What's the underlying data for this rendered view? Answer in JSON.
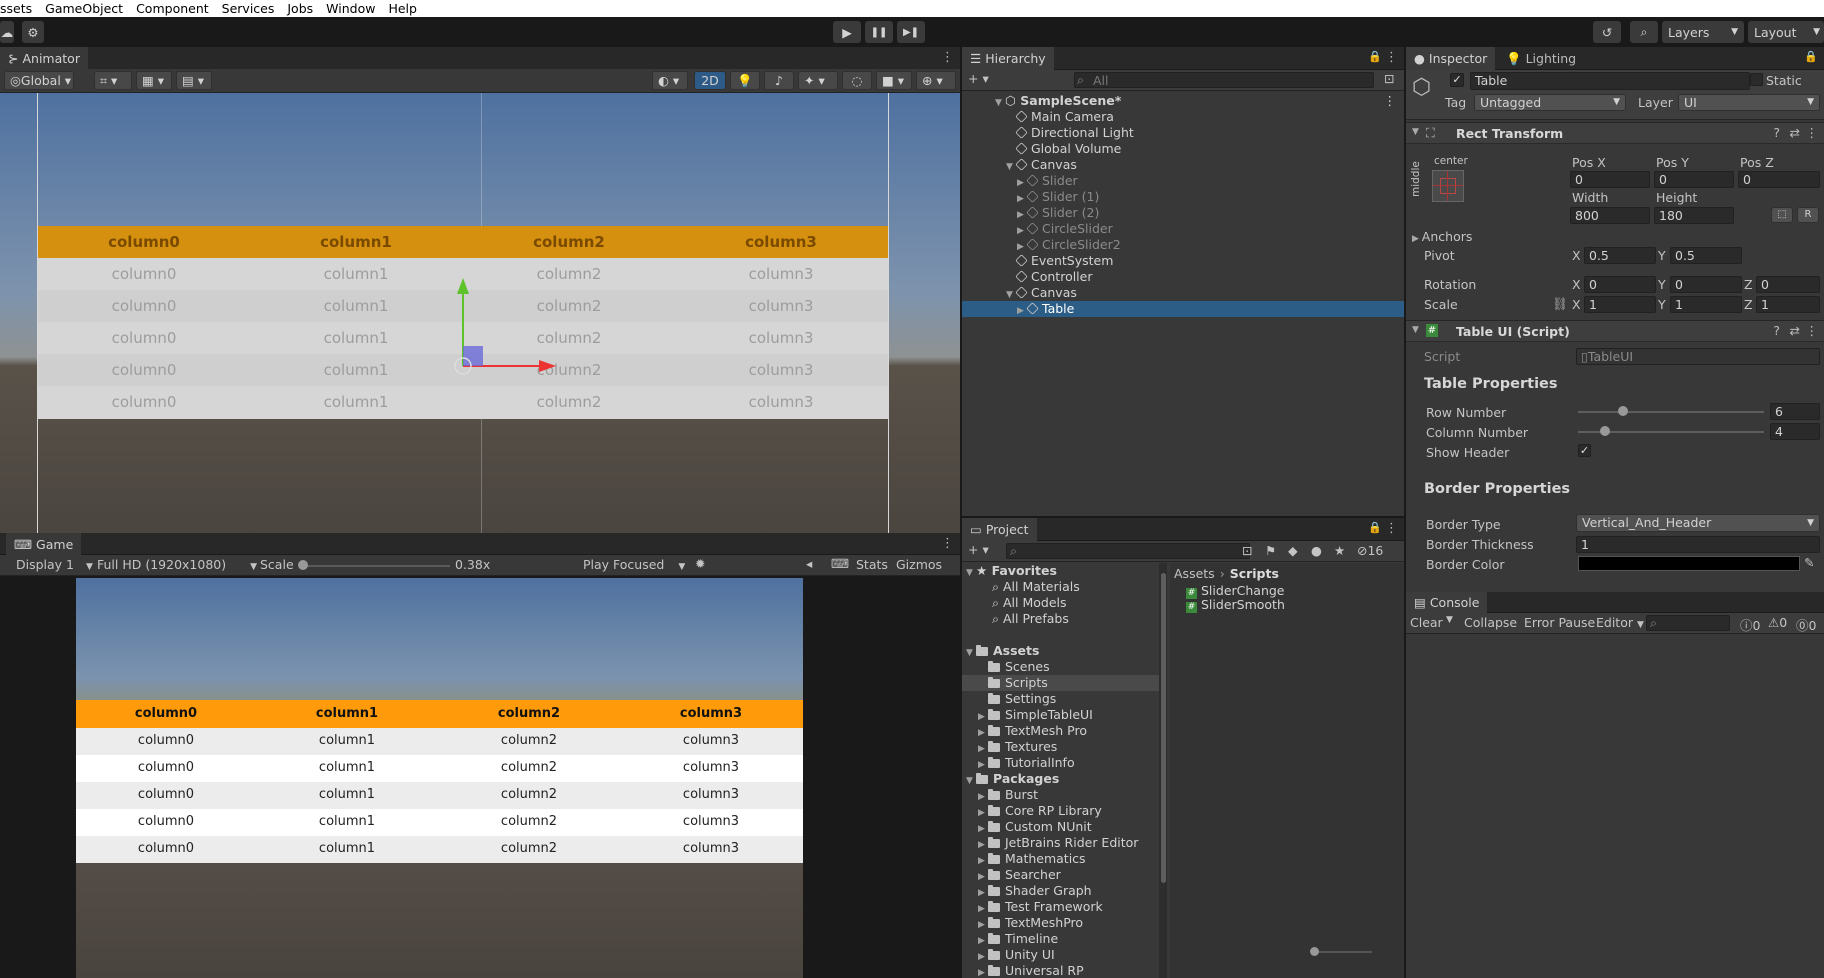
{
  "menu": [
    "ssets",
    "GameObject",
    "Component",
    "Services",
    "Jobs",
    "Window",
    "Help"
  ],
  "toolbar": {
    "play": "▶",
    "pause": "❚❚",
    "step": "▶❚",
    "layers": "Layers",
    "layout": "Layout"
  },
  "animator": {
    "tab": "Animator",
    "global": "Global",
    "btn_2d": "2D",
    "table": {
      "headers": [
        "column0",
        "column1",
        "column2",
        "column3"
      ],
      "rows": [
        [
          "column0",
          "column1",
          "column2",
          "column3"
        ],
        [
          "column0",
          "column1",
          "column2",
          "column3"
        ],
        [
          "column0",
          "column1",
          "column2",
          "column3"
        ],
        [
          "column0",
          "column1",
          "column2",
          "column3"
        ],
        [
          "column0",
          "column1",
          "column2",
          "column3"
        ]
      ]
    }
  },
  "game": {
    "tab": "Game",
    "display": "Display 1",
    "resolution": "Full HD (1920x1080)",
    "scale_label": "Scale",
    "scale_value": "0.38x",
    "play_focused": "Play Focused",
    "stats": "Stats",
    "gizmos": "Gizmos"
  },
  "hierarchy": {
    "tab": "Hierarchy",
    "search_placeholder": "All",
    "scene": "SampleScene*",
    "items": [
      {
        "label": "Main Camera",
        "faded": false,
        "selected": false
      },
      {
        "label": "Directional Light",
        "faded": false,
        "selected": false
      },
      {
        "label": "Global Volume",
        "faded": false,
        "selected": false
      },
      {
        "label": "Canvas",
        "faded": false,
        "selected": false
      },
      {
        "label": "Slider",
        "faded": true,
        "selected": false
      },
      {
        "label": "Slider (1)",
        "faded": true,
        "selected": false
      },
      {
        "label": "Slider (2)",
        "faded": true,
        "selected": false
      },
      {
        "label": "CircleSlider",
        "faded": true,
        "selected": false
      },
      {
        "label": "CircleSlider2",
        "faded": true,
        "selected": false
      },
      {
        "label": "EventSystem",
        "faded": false,
        "selected": false
      },
      {
        "label": "Controller",
        "faded": false,
        "selected": false
      },
      {
        "label": "Canvas",
        "faded": false,
        "selected": false
      },
      {
        "label": "Table",
        "faded": false,
        "selected": true
      }
    ]
  },
  "project": {
    "tab": "Project",
    "count": "16",
    "favorites_title": "Favorites",
    "favorites": [
      "All Materials",
      "All Models",
      "All Prefabs"
    ],
    "assets_title": "Assets",
    "assets": [
      "Scenes",
      "Scripts",
      "Settings",
      "SimpleTableUI",
      "TextMesh Pro",
      "Textures",
      "TutorialInfo"
    ],
    "packages_title": "Packages",
    "packages": [
      "Burst",
      "Core RP Library",
      "Custom NUnit",
      "JetBrains Rider Editor",
      "Mathematics",
      "Searcher",
      "Shader Graph",
      "Test Framework",
      "TextMeshPro",
      "Timeline",
      "Unity UI",
      "Universal RP"
    ],
    "breadcrumb": [
      "Assets",
      "Scripts"
    ],
    "files": [
      "SliderChange",
      "SliderSmooth"
    ]
  },
  "inspector": {
    "tab": "Inspector",
    "tab2": "Lighting",
    "object_name": "Table",
    "static": "Static",
    "tag_label": "Tag",
    "tag": "Untagged",
    "layer_label": "Layer",
    "layer": "UI",
    "rect_title": "Rect Transform",
    "anchor_h": "center",
    "anchor_v": "middle",
    "pos_x_label": "Pos X",
    "pos_y_label": "Pos Y",
    "pos_z_label": "Pos Z",
    "pos_x": "0",
    "pos_y": "0",
    "pos_z": "0",
    "width_label": "Width",
    "height_label": "Height",
    "width": "800",
    "height": "180",
    "r_btn": "R",
    "anchors": "Anchors",
    "pivot": "Pivot",
    "pivot_x": "0.5",
    "pivot_y": "0.5",
    "rotation": "Rotation",
    "rot_x": "0",
    "rot_y": "0",
    "rot_z": "0",
    "scale": "Scale",
    "scale_x": "1",
    "scale_y": "1",
    "scale_z": "1",
    "script_title": "Table UI (Script)",
    "script_label": "Script",
    "script_value": "TableUI",
    "table_props": "Table Properties",
    "row_label": "Row Number",
    "row_value": "6",
    "col_label": "Column Number",
    "col_value": "4",
    "show_header": "Show Header",
    "border_props": "Border Properties",
    "border_type_label": "Border Type",
    "border_type": "Vertical_And_Header",
    "border_thick_label": "Border Thickness",
    "border_thick": "1",
    "border_color_label": "Border Color",
    "border_color": "#000000"
  },
  "console": {
    "tab": "Console",
    "clear": "Clear",
    "collapse": "Collapse",
    "error_pause": "Error Pause",
    "editor": "Editor",
    "c1": "0",
    "c2": "0",
    "c3": "0"
  },
  "colors": {
    "accent": "#2c5d87",
    "header_orange": "#ff9a0a",
    "scene_header": "#d4900e"
  }
}
